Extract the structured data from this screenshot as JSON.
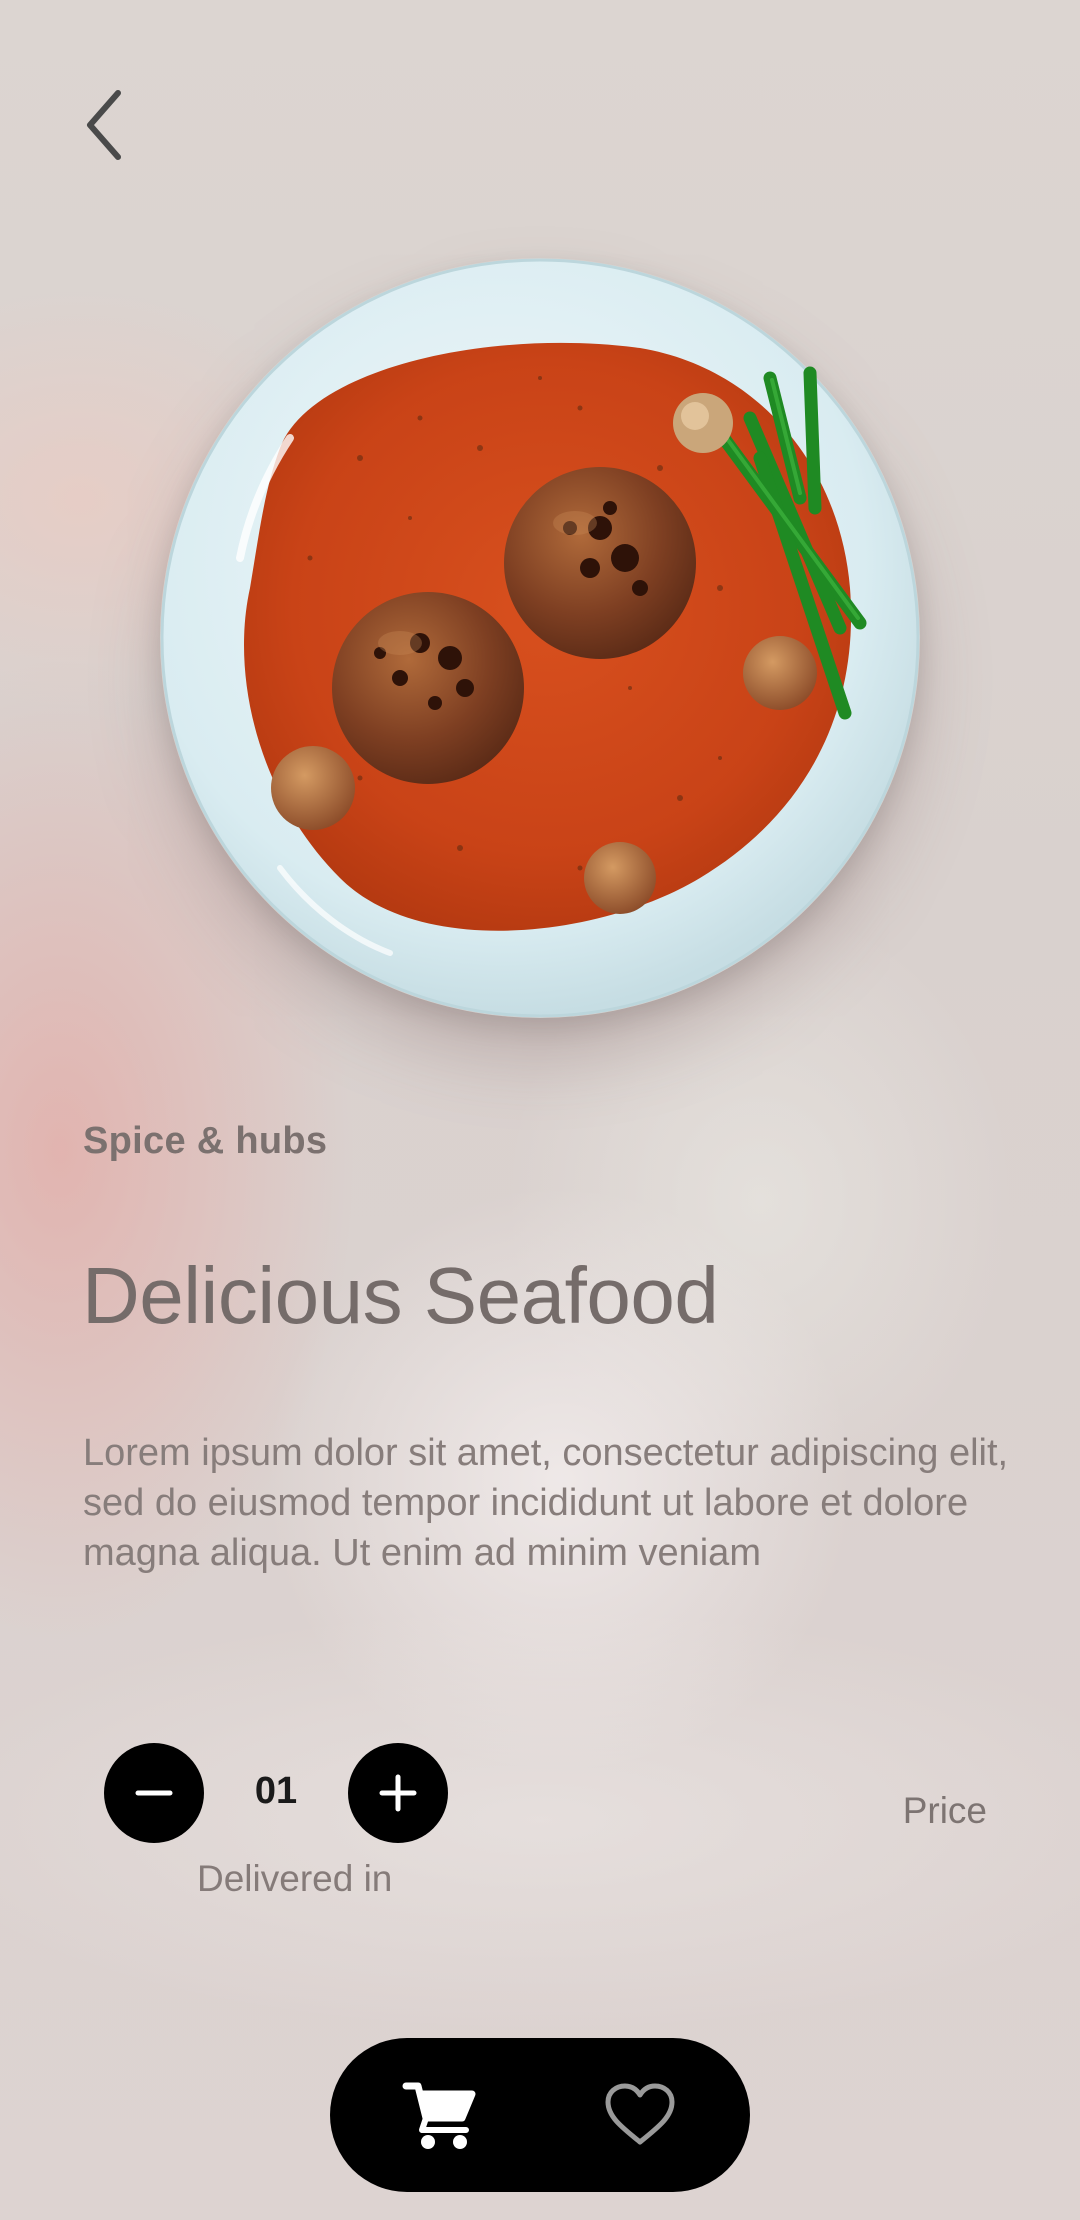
{
  "header": {
    "back_icon": "chevron-left-icon"
  },
  "dish": {
    "image_icon": "plate-of-meatballs-in-tomato-sauce",
    "category": "Spice & hubs",
    "title": "Delicious Seafood",
    "description": "Lorem ipsum dolor sit amet, consectetur adipiscing elit, sed do eiusmod tempor incididunt ut labore et dolore magna aliqua. Ut enim ad minim veniam"
  },
  "quantity": {
    "value": "01",
    "minus_icon": "minus-icon",
    "plus_icon": "plus-icon"
  },
  "delivery": {
    "label": "Delivered in"
  },
  "price": {
    "label": "Price"
  },
  "bottom_bar": {
    "cart_icon": "cart-icon",
    "favorite_icon": "heart-outline-icon"
  },
  "colors": {
    "button_bg": "#000000",
    "text_primary": "#756c6a",
    "text_secondary": "#877d7b"
  }
}
